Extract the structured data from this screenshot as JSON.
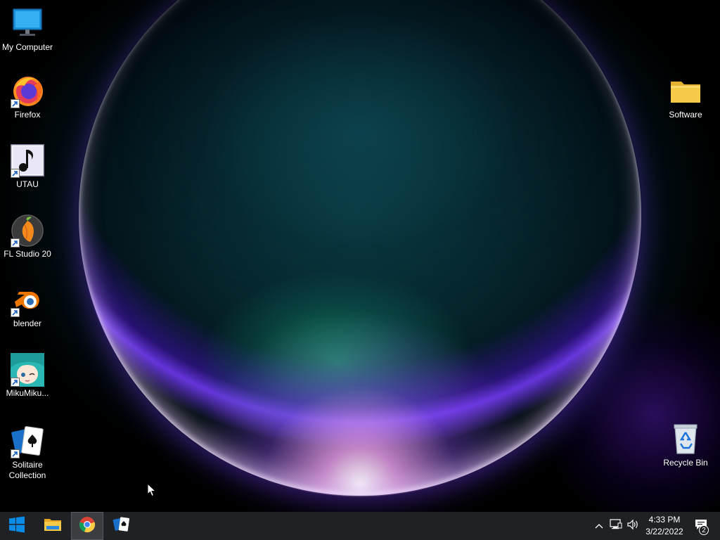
{
  "desktop": {
    "icons_left": [
      {
        "label": "My Computer",
        "icon": "monitor-icon",
        "shortcut": false
      },
      {
        "label": "Firefox",
        "icon": "firefox-icon",
        "shortcut": true
      },
      {
        "label": "UTAU",
        "icon": "utau-icon",
        "shortcut": true
      },
      {
        "label": "FL Studio 20",
        "icon": "fl-studio-icon",
        "shortcut": true
      },
      {
        "label": "blender",
        "icon": "blender-icon",
        "shortcut": true
      },
      {
        "label": "MikuMiku...",
        "icon": "mikumikudance-icon",
        "shortcut": true
      },
      {
        "label": "Solitaire Collection",
        "icon": "solitaire-icon",
        "shortcut": true
      }
    ],
    "icons_right": [
      {
        "label": "Software",
        "icon": "folder-icon",
        "shortcut": false
      },
      {
        "label": "Recycle Bin",
        "icon": "recycle-bin-icon",
        "shortcut": false
      }
    ]
  },
  "taskbar": {
    "start": {
      "icon": "windows-start-icon"
    },
    "pinned": [
      {
        "name": "File Explorer",
        "icon": "file-explorer-icon",
        "active": false
      },
      {
        "name": "Google Chrome",
        "icon": "chrome-icon",
        "active": true
      },
      {
        "name": "Solitaire Collection",
        "icon": "solitaire-icon",
        "active": false
      }
    ],
    "tray": {
      "icons": [
        "chevron-up-icon",
        "network-icon",
        "volume-icon"
      ],
      "time": "4:33 PM",
      "date": "3/22/2022",
      "notification_count": "2"
    }
  },
  "colors": {
    "taskbar_bg": "#1f2124",
    "accent_blue": "#0078d7",
    "folder_yellow": "#f7c948"
  }
}
